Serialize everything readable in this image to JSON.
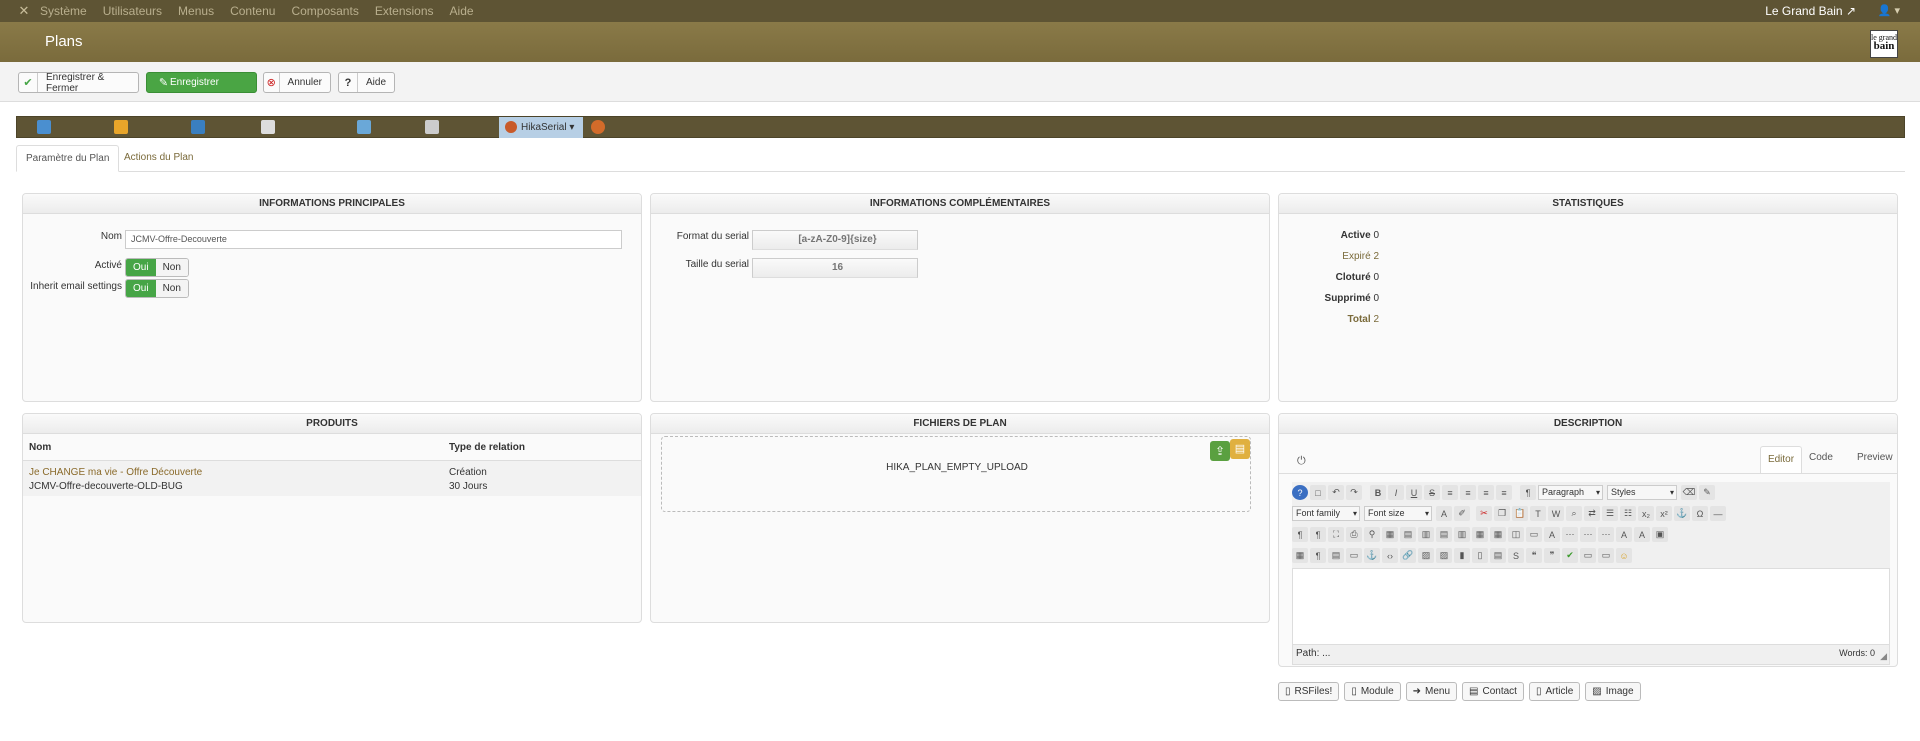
{
  "nav": {
    "logo_icon": "joomla-icon",
    "menu": [
      "Système",
      "Utilisateurs",
      "Menus",
      "Contenu",
      "Composants",
      "Extensions",
      "Aide"
    ],
    "site_link": "Le Grand Bain",
    "user_icon": "user-icon"
  },
  "header": {
    "title": "Plans",
    "brand_text": "le grand bain"
  },
  "toolbar": {
    "save_close": "Enregistrer & Fermer",
    "save": "Enregistrer",
    "cancel": "Annuler",
    "help": "Aide"
  },
  "component_tab": "HikaSerial",
  "subtabs": [
    "Paramètre du Plan",
    "Actions du Plan"
  ],
  "main_info": {
    "heading": "INFORMATIONS PRINCIPALES",
    "name_label": "Nom",
    "name_value": "JCMV-Offre-Decouverte",
    "active_label": "Activé",
    "inherit_label": "Inherit email settings",
    "yes": "Oui",
    "no": "Non"
  },
  "extra_info": {
    "heading": "INFORMATIONS COMPLÉMENTAIRES",
    "format_label": "Format du serial",
    "format_placeholder": "[a-zA-Z0-9]{size}",
    "size_label": "Taille du serial",
    "size_placeholder": "16"
  },
  "stats": {
    "heading": "STATISTIQUES",
    "rows": [
      {
        "label": "Active",
        "value": "0"
      },
      {
        "label": "Expiré",
        "value": "2"
      },
      {
        "label": "Cloturé",
        "value": "0"
      },
      {
        "label": "Supprimé",
        "value": "0"
      },
      {
        "label": "Total",
        "value": "2"
      }
    ]
  },
  "products": {
    "heading": "PRODUITS",
    "col_name": "Nom",
    "col_type": "Type de relation",
    "rows": [
      {
        "name": "Je CHANGE ma vie - Offre Découverte",
        "sub": "JCMV-Offre-decouverte-OLD-BUG",
        "type": "Création",
        "duration": "30 Jours"
      }
    ]
  },
  "files": {
    "heading": "FICHIERS DE PLAN",
    "empty": "HIKA_PLAN_EMPTY_UPLOAD"
  },
  "description": {
    "heading": "DESCRIPTION",
    "tabs": [
      "Editor",
      "Code",
      "Preview"
    ],
    "paragraph": "Paragraph",
    "styles": "Styles",
    "font_family": "Font family",
    "font_size": "Font size",
    "path": "Path: ...",
    "words": "Words: 0",
    "buttons": [
      "RSFiles!",
      "Module",
      "Menu",
      "Contact",
      "Article",
      "Image"
    ]
  },
  "colors": {
    "nav_bg": "#5e5434",
    "title_bg": "#7f7040",
    "green": "#46a546",
    "active_tab": "#b7cfe5"
  }
}
